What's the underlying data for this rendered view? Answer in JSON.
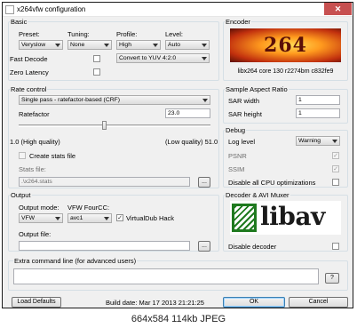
{
  "window": {
    "title": "x264vfw configuration",
    "close_label": "✕"
  },
  "basic": {
    "title": "Basic",
    "preset_label": "Preset:",
    "preset_value": "Veryslow",
    "tuning_label": "Tuning:",
    "tuning_value": "None",
    "profile_label": "Profile:",
    "profile_value": "High",
    "level_label": "Level:",
    "level_value": "Auto",
    "fast_decode_label": "Fast Decode",
    "zero_latency_label": "Zero Latency",
    "colorspace_value": "Convert to YUV 4:2:0"
  },
  "encoder": {
    "title": "Encoder",
    "logo_text": "264",
    "version": "libx264 core 130 r2274bm c832fe9"
  },
  "rate_control": {
    "title": "Rate control",
    "mode_value": "Single pass - ratefactor-based (CRF)",
    "ratefactor_label": "Ratefactor",
    "ratefactor_value": "23.0",
    "slider_fraction": 0.45,
    "high_quality_label": "1.0 (High quality)",
    "low_quality_label": "(Low quality) 51.0",
    "create_stats_label": "Create stats file",
    "stats_file_label": "Stats file:",
    "stats_file_value": ".\\x264.stats",
    "browse_label": "..."
  },
  "sar": {
    "title": "Sample Aspect Ratio",
    "width_label": "SAR width",
    "width_value": "1",
    "height_label": "SAR height",
    "height_value": "1"
  },
  "debug": {
    "title": "Debug",
    "log_level_label": "Log level",
    "log_level_value": "Warning",
    "psnr_label": "PSNR",
    "ssim_label": "SSIM",
    "disable_cpu_label": "Disable all CPU optimizations"
  },
  "output": {
    "title": "Output",
    "mode_label": "Output mode:",
    "mode_value": "VFW",
    "fourcc_label": "VFW FourCC:",
    "fourcc_value": "avc1",
    "virtualdub_label": "VirtualDub Hack",
    "file_label": "Output file:",
    "file_value": "",
    "browse_label": "..."
  },
  "decoder": {
    "title": "Decoder & AVI Muxer",
    "logo_text": "libav",
    "disable_label": "Disable decoder"
  },
  "extra": {
    "title": "Extra command line (for advanced users)",
    "help_label": "?"
  },
  "footer": {
    "load_defaults": "Load Defaults",
    "build_date": "Build date: Mar 17 2013 21:21:25",
    "ok": "OK",
    "cancel": "Cancel"
  },
  "status_bar": "664x584 114kb JPEG",
  "colors": {
    "libav_green": "#1f7a1f",
    "logo_red": "#b3261e",
    "close_red": "#c75050"
  }
}
